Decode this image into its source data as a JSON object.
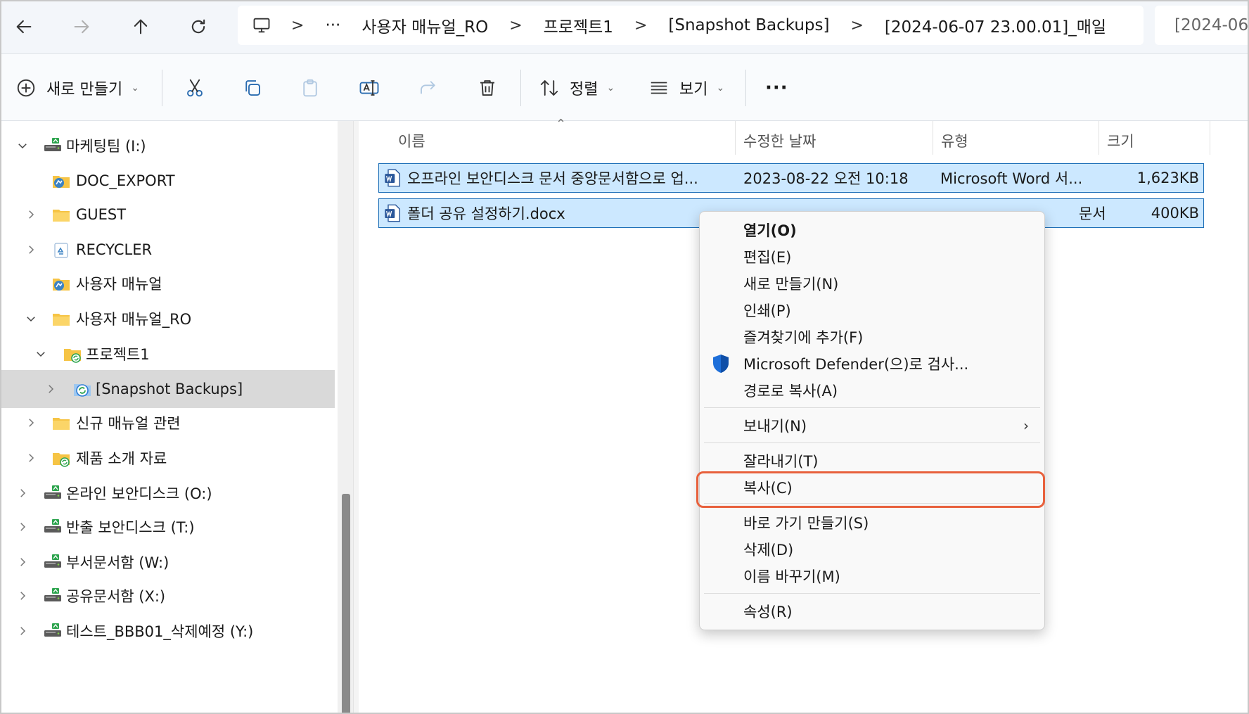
{
  "breadcrumb": {
    "segments": [
      "사용자 매뉴얼_RO",
      "프로젝트1",
      "[Snapshot Backups]",
      "[2024-06-07 23.00.01]_매일"
    ],
    "ellipsis": "···",
    "next_tab": "[2024-06-"
  },
  "toolbar": {
    "new_label": "새로 만들기",
    "sort_label": "정렬",
    "view_label": "보기",
    "more_label": "···"
  },
  "nav_tree": [
    {
      "label": "마케팅팀 (I:)",
      "icon": "network-drive-icon"
    },
    {
      "label": "DOC_EXPORT",
      "icon": "shared-folder-icon"
    },
    {
      "label": "GUEST",
      "icon": "folder-icon"
    },
    {
      "label": "RECYCLER",
      "icon": "recycle-folder-icon"
    },
    {
      "label": "사용자 매뉴얼",
      "icon": "shared-folder-icon"
    },
    {
      "label": "사용자 매뉴얼_RO",
      "icon": "folder-icon"
    },
    {
      "label": "프로젝트1",
      "icon": "sync-folder-icon"
    },
    {
      "label": "[Snapshot Backups]",
      "icon": "snapshot-folder-icon"
    },
    {
      "label": "신규 매뉴얼 관련",
      "icon": "folder-icon"
    },
    {
      "label": "제품 소개 자료",
      "icon": "sync-folder-icon"
    },
    {
      "label": "온라인 보안디스크 (O:)",
      "icon": "network-drive-icon"
    },
    {
      "label": "반출 보안디스크 (T:)",
      "icon": "network-drive-icon"
    },
    {
      "label": "부서문서함 (W:)",
      "icon": "network-drive-icon"
    },
    {
      "label": "공유문서함 (X:)",
      "icon": "network-drive-icon"
    },
    {
      "label": "테스트_BBB01_삭제예정 (Y:)",
      "icon": "network-drive-icon"
    }
  ],
  "columns": {
    "name": "이름",
    "modified": "수정한 날짜",
    "type": "유형",
    "size": "크기"
  },
  "files": [
    {
      "name": "오프라인 보안디스크 문서 중앙문서함으로 업...",
      "modified": "2023-08-22 오전 10:18",
      "type": "Microsoft Word 서...",
      "size": "1,623KB"
    },
    {
      "name": "폴더 공유 설정하기.docx",
      "modified": "",
      "type": "문서",
      "size": "400KB"
    }
  ],
  "context_menu": {
    "groups": [
      [
        "열기(O)",
        "편집(E)",
        "새로 만들기(N)",
        "인쇄(P)",
        "즐겨찾기에 추가(F)",
        "Microsoft Defender(으)로 검사...",
        "경로로 복사(A)"
      ],
      [
        "보내기(N)"
      ],
      [
        "잘라내기(T)",
        "복사(C)"
      ],
      [
        "바로 가기 만들기(S)",
        "삭제(D)",
        "이름 바꾸기(M)"
      ],
      [
        "속성(R)"
      ]
    ],
    "submenu_arrow": "›",
    "highlighted": "복사(C)"
  },
  "colors": {
    "selection_bg": "#cce8ff",
    "selection_border": "#1e6fb8",
    "highlight_box": "#e8613d",
    "folder": "#f6c445"
  }
}
